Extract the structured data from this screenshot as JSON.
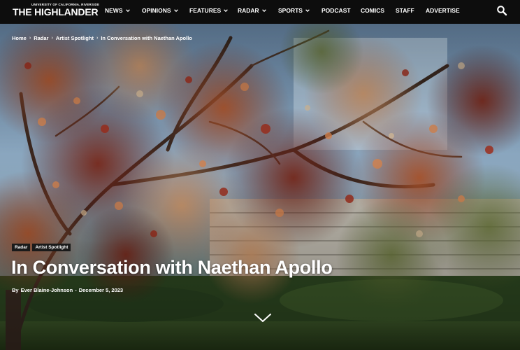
{
  "site": {
    "logo_small": "UNIVERSITY OF CALIFORNIA, RIVERSIDE",
    "logo_big": "THE HIGHLANDER"
  },
  "nav": {
    "items": [
      {
        "label": "NEWS",
        "dropdown": true
      },
      {
        "label": "OPINIONS",
        "dropdown": true
      },
      {
        "label": "FEATURES",
        "dropdown": true
      },
      {
        "label": "RADAR",
        "dropdown": true
      },
      {
        "label": "SPORTS",
        "dropdown": true
      },
      {
        "label": "PODCAST",
        "dropdown": false
      },
      {
        "label": "COMICS",
        "dropdown": false
      },
      {
        "label": "STAFF",
        "dropdown": false
      },
      {
        "label": "ADVERTISE",
        "dropdown": false
      }
    ],
    "search_icon": "search-icon"
  },
  "breadcrumb": {
    "items": [
      "Home",
      "Radar",
      "Artist Spotlight",
      "In Conversation with Naethan Apollo"
    ],
    "separator": "›"
  },
  "article": {
    "categories": [
      "Radar",
      "Artist Spotlight"
    ],
    "title": "In Conversation with Naethan Apollo",
    "by": "By",
    "author": "Ever Blaine-Johnson",
    "dash": "-",
    "date": "December 5, 2023"
  },
  "colors": {
    "nav_bg": "#0d0d0d",
    "text": "#ffffff",
    "category_bg": "#1a1a1a"
  }
}
